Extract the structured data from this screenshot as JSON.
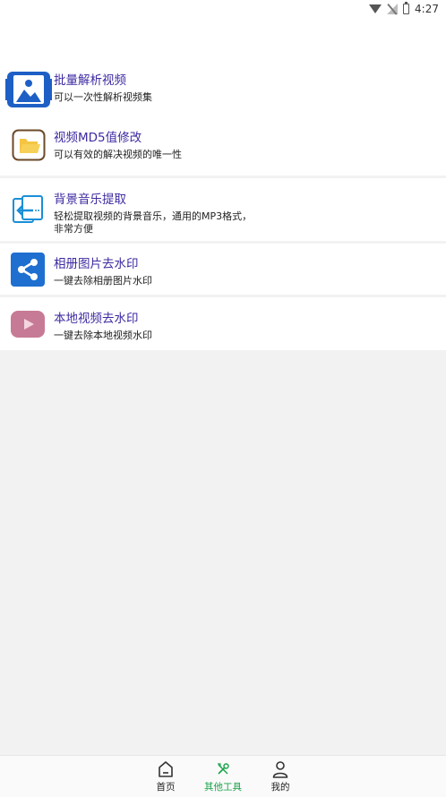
{
  "status_bar": {
    "time": "4:27"
  },
  "tools": [
    {
      "title": "批量解析视频",
      "desc": "可以一次性解析视频集",
      "icon": "image-gallery-icon"
    },
    {
      "title": "视频MD5值修改",
      "desc": "可以有效的解决视频的唯一性",
      "icon": "folder-icon"
    },
    {
      "title": "背景音乐提取",
      "desc_line1": "轻松提取视频的背景音乐，通用的MP3格式，",
      "desc_line2": "非常方便",
      "icon": "extract-arrow-icon"
    },
    {
      "title": "相册图片去水印",
      "desc": "一键去除相册图片水印",
      "icon": "share-icon"
    },
    {
      "title": "本地视频去水印",
      "desc": "一键去除本地视频水印",
      "icon": "play-video-icon"
    }
  ],
  "bottom_nav": [
    {
      "label": "首页",
      "icon": "home-icon",
      "active": false
    },
    {
      "label": "其他工具",
      "icon": "tools-icon",
      "active": true
    },
    {
      "label": "我的",
      "icon": "user-icon",
      "active": false
    }
  ],
  "colors": {
    "title": "#3d2aa0",
    "active_tab": "#1aa34a",
    "background": "#f2f2f2"
  }
}
